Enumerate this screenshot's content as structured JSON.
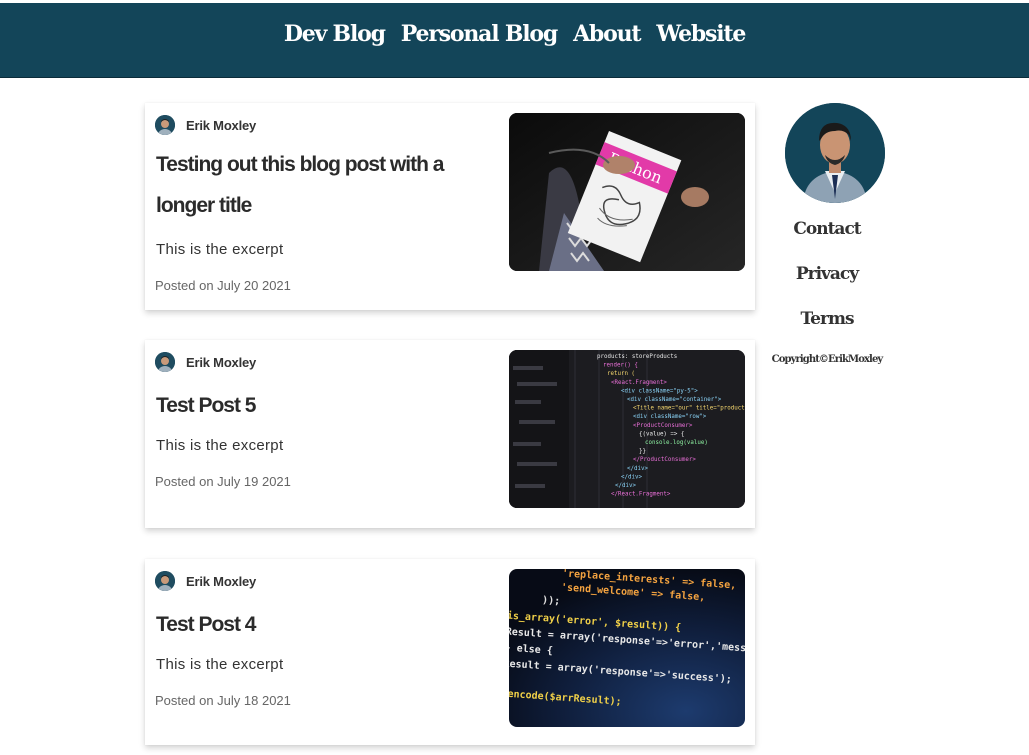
{
  "nav": {
    "links": [
      "Dev Blog",
      "Personal Blog",
      "About",
      "Website"
    ]
  },
  "posts": [
    {
      "author": "Erik Moxley",
      "title": "Testing out this blog post with a longer title",
      "excerpt": "This is the excerpt",
      "date": "Posted on July 20 2021",
      "image_label": "python-book-image"
    },
    {
      "author": "Erik Moxley",
      "title": "Test Post 5",
      "excerpt": "This is the excerpt",
      "date": "Posted on July 19 2021",
      "image_label": "react-code-image"
    },
    {
      "author": "Erik Moxley",
      "title": "Test Post 4",
      "excerpt": "This is the excerpt",
      "date": "Posted on July 18 2021",
      "image_label": "php-code-image"
    }
  ],
  "sidebar": {
    "links": [
      "Contact",
      "Privacy",
      "Terms"
    ],
    "copyright": "Copyright©ErikMoxley"
  },
  "code": {
    "react": [
      "products: storeProducts",
      "render() {",
      "return (",
      "<React.Fragment>",
      "<div className=\"py-5\">",
      "<div className=\"container\">",
      "<Title name=\"our\" title=\"product",
      "<div className=\"row\">",
      "<ProductConsumer>",
      "{(value) => {",
      "console.log(value)",
      "}}",
      "</ProductConsumer>",
      "</div>",
      "</div>",
      "</div>",
      "</React.Fragment>"
    ],
    "php": [
      "'replace_interests' => false,",
      "'send_welcome'      => false,",
      "));",
      "is_array('error', $result)) {",
      "Result = array('response'=>'error','message'",
      "} else {",
      "Result = array('response'=>'success');",
      "}",
      "_encode($arrResult);"
    ],
    "book_title": "Python"
  },
  "colors": {
    "nav_bg": "#134559",
    "avatar_bg": "#134559"
  }
}
